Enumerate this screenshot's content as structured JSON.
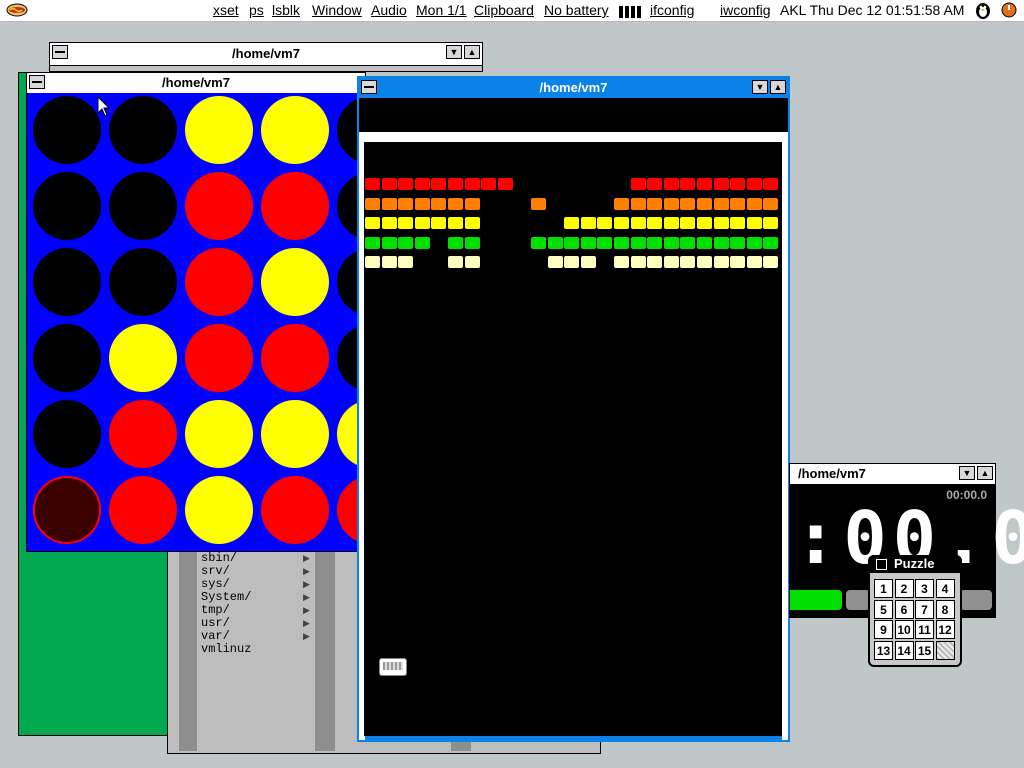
{
  "topbar": {
    "menu_icon": "hotdog-icon",
    "items": [
      "xset",
      "ps",
      "lsblk",
      "Window",
      "Audio",
      "Mon 1/1",
      "Clipboard",
      "No battery"
    ],
    "battery_icon": "battery-bars-icon",
    "ifconfig": "ifconfig",
    "iwconfig": "iwconfig",
    "datetime": "AKL Thu Dec 12 01:51:58 AM",
    "user_icon": "penguin-icon",
    "power_icon": "power-icon"
  },
  "windows": {
    "back_title": "/home/vm7",
    "connect4_title": "/home/vm7",
    "breakout_title": "/home/vm7",
    "clock_title": "/home/vm7"
  },
  "file_list": [
    "sbin/",
    "srv/",
    "sys/",
    "System/",
    "tmp/",
    "usr/",
    "var/",
    "vmlinuz"
  ],
  "connect4": {
    "colors": {
      "blue": "#0000ff",
      "red": "#ff0000",
      "yellow": "#ffff00",
      "black": "#000000",
      "dark": "#3a0000"
    },
    "grid": [
      [
        "black",
        "black",
        "yellow",
        "yellow",
        "black"
      ],
      [
        "black",
        "black",
        "red",
        "red",
        "black"
      ],
      [
        "black",
        "black",
        "red",
        "yellow",
        "black"
      ],
      [
        "black",
        "yellow",
        "red",
        "red",
        "black"
      ],
      [
        "black",
        "red",
        "yellow",
        "yellow",
        "yellow"
      ],
      [
        "dark",
        "red",
        "yellow",
        "red",
        "red"
      ]
    ]
  },
  "breakout": {
    "colors": {
      "red": "#ff0000",
      "orange": "#ff8000",
      "yellow": "#ffff00",
      "green": "#00e000",
      "cream": "#ffffc0"
    },
    "rows": [
      {
        "color": "red",
        "bricks": [
          0,
          1,
          2,
          3,
          4,
          5,
          6,
          7,
          8,
          16,
          17,
          18,
          19,
          20,
          21,
          22,
          23,
          24
        ]
      },
      {
        "color": "orange",
        "bricks": [
          0,
          1,
          2,
          3,
          4,
          5,
          6,
          10,
          15,
          16,
          17,
          18,
          19,
          20,
          21,
          22,
          23,
          24
        ]
      },
      {
        "color": "yellow",
        "bricks": [
          0,
          1,
          2,
          3,
          4,
          5,
          6,
          12,
          13,
          14,
          15,
          16,
          17,
          18,
          19,
          20,
          21,
          22,
          23,
          24
        ]
      },
      {
        "color": "green",
        "bricks": [
          0,
          1,
          2,
          3,
          5,
          6,
          10,
          11,
          12,
          13,
          14,
          15,
          16,
          17,
          18,
          19,
          20,
          21,
          22,
          23,
          24
        ]
      },
      {
        "color": "cream",
        "bricks": [
          0,
          1,
          2,
          5,
          6,
          11,
          12,
          13,
          15,
          16,
          17,
          18,
          19,
          20,
          21,
          22,
          23,
          24
        ]
      }
    ]
  },
  "clock": {
    "small_time": "00:00.0",
    "big_time": ":00.0"
  },
  "puzzle": {
    "label": "Puzzle",
    "tiles": [
      "1",
      "2",
      "3",
      "4",
      "5",
      "6",
      "7",
      "8",
      "9",
      "10",
      "11",
      "12",
      "13",
      "14",
      "15",
      ""
    ]
  }
}
